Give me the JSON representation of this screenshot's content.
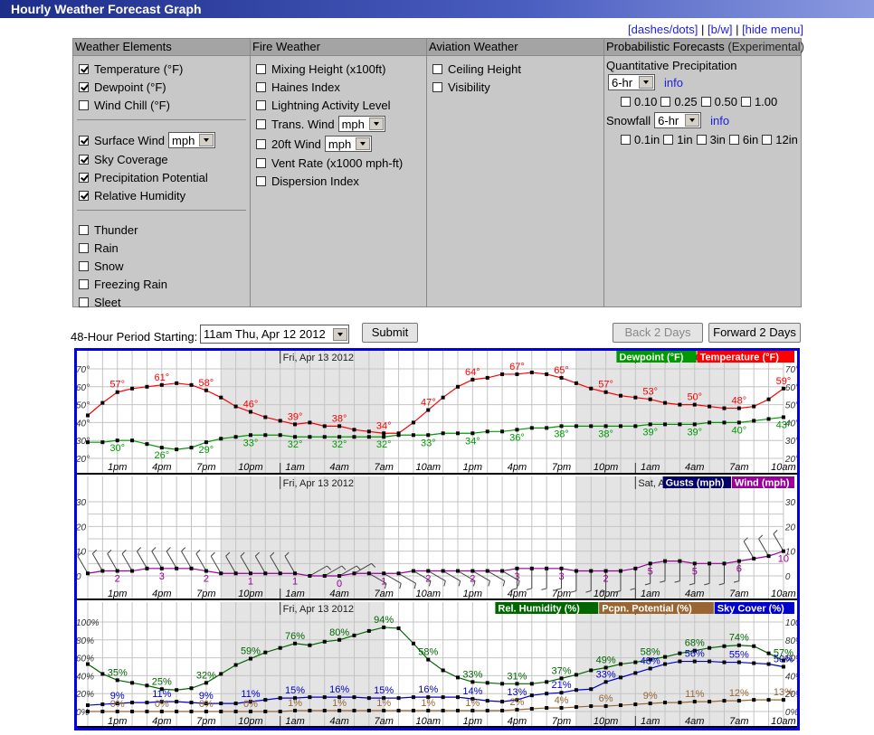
{
  "title": "Hourly Weather Forecast Graph",
  "links": [
    "[dashes/dots]",
    "[b/w]",
    "[hide menu]"
  ],
  "link_sep": " | ",
  "form": {
    "columns": [
      {
        "header": "Weather Elements",
        "groups": [
          [
            {
              "label": "Temperature (°F)",
              "checked": true
            },
            {
              "label": "Dewpoint (°F)",
              "checked": true
            },
            {
              "label": "Wind Chill (°F)",
              "checked": false
            }
          ],
          [
            {
              "label": "Surface Wind",
              "checked": true,
              "select": "mph"
            },
            {
              "label": "Sky Coverage",
              "checked": true
            },
            {
              "label": "Precipitation Potential",
              "checked": true
            },
            {
              "label": "Relative Humidity",
              "checked": true
            }
          ],
          [
            {
              "label": "Thunder",
              "checked": false
            },
            {
              "label": "Rain",
              "checked": false
            },
            {
              "label": "Snow",
              "checked": false
            },
            {
              "label": "Freezing Rain",
              "checked": false
            },
            {
              "label": "Sleet",
              "checked": false
            }
          ]
        ]
      },
      {
        "header": "Fire Weather",
        "groups": [
          [
            {
              "label": "Mixing Height (x100ft)",
              "checked": false
            },
            {
              "label": "Haines Index",
              "checked": false
            },
            {
              "label": "Lightning Activity Level",
              "checked": false
            },
            {
              "label": "Trans. Wind",
              "checked": false,
              "select": "mph"
            },
            {
              "label": "20ft Wind",
              "checked": false,
              "select": "mph"
            },
            {
              "label": "Vent Rate (x1000 mph-ft)",
              "checked": false
            },
            {
              "label": "Dispersion Index",
              "checked": false
            }
          ]
        ]
      },
      {
        "header": "Aviation Weather",
        "groups": [
          [
            {
              "label": "Ceiling Height",
              "checked": false
            },
            {
              "label": "Visibility",
              "checked": false
            }
          ]
        ]
      }
    ],
    "prob": {
      "header": "Probabilistic Forecasts",
      "header_note": "(Experimental)",
      "qpf_label": "Quantitative Precipitation",
      "qpf_select": "6-hr",
      "qpf_info": "info",
      "qpf_options": [
        {
          "label": "0.10",
          "checked": false
        },
        {
          "label": "0.25",
          "checked": false
        },
        {
          "label": "0.50",
          "checked": false
        },
        {
          "label": "1.00",
          "checked": false
        }
      ],
      "snow_label": "Snowfall",
      "snow_select": "6-hr",
      "snow_info": "info",
      "snow_options": [
        {
          "label": "0.1in",
          "checked": false
        },
        {
          "label": "1in",
          "checked": false
        },
        {
          "label": "3in",
          "checked": false
        },
        {
          "label": "6in",
          "checked": false
        },
        {
          "label": "12in",
          "checked": false
        }
      ]
    }
  },
  "period": {
    "label": "48-Hour Period Starting:",
    "value": "11am Thu, Apr 12 2012",
    "submit": "Submit",
    "back": "Back 2 Days",
    "back_disabled": true,
    "forward": "Forward 2 Days"
  },
  "chart_data": {
    "type": "line",
    "start": "11am Thu, Apr 12 2012",
    "interval_hours": 1,
    "x_tick_labels": [
      "1pm",
      "4pm",
      "7pm",
      "10pm",
      "1am",
      "4am",
      "7am",
      "10am",
      "1pm",
      "4pm",
      "7pm",
      "10pm",
      "1am",
      "4am",
      "7am",
      "10am"
    ],
    "day_labels": [
      "Fri, Apr 13 2012",
      "Sat, Apr 14 2012"
    ],
    "night_shading": "8pm–7am",
    "colors": {
      "temperature": "#ff0000",
      "dewpoint": "#009900",
      "wind": "#990099",
      "gusts": "#000066",
      "rh": "#006600",
      "pcpn": "#996633",
      "sky": "#0000cc",
      "border": "#0000ee"
    },
    "panels": [
      {
        "ylim": [
          20,
          70
        ],
        "yticks": [
          "20°",
          "30°",
          "40°",
          "50°",
          "60°",
          "70°"
        ],
        "ytick_values": [
          20,
          30,
          40,
          50,
          60,
          70
        ],
        "legend": [
          "Dewpoint (°F)",
          "Temperature (°F)"
        ],
        "series": [
          {
            "name": "Temperature (°F)",
            "key": "temperature",
            "label_suffix": "°",
            "label_pos": "above",
            "values": [
              44,
              51,
              57,
              59,
              60,
              61,
              62,
              61,
              58,
              54,
              49,
              46,
              43,
              41,
              39,
              40,
              38,
              38,
              36,
              35,
              34,
              34,
              40,
              47,
              54,
              60,
              64,
              65,
              67,
              67,
              68,
              67,
              65,
              62,
              59,
              57,
              55,
              54,
              53,
              51,
              50,
              50,
              49,
              48,
              48,
              49,
              53,
              59
            ]
          },
          {
            "name": "Dewpoint (°F)",
            "key": "dewpoint",
            "label_suffix": "°",
            "label_pos": "below",
            "values": [
              29,
              29,
              30,
              30,
              28,
              26,
              25,
              26,
              29,
              31,
              32,
              33,
              33,
              33,
              32,
              32,
              32,
              32,
              32,
              32,
              32,
              33,
              33,
              33,
              34,
              34,
              34,
              35,
              35,
              36,
              37,
              37,
              38,
              38,
              38,
              38,
              38,
              38,
              39,
              39,
              39,
              39,
              40,
              40,
              40,
              41,
              42,
              43
            ]
          }
        ]
      },
      {
        "ylim": [
          0,
          30
        ],
        "yticks": [
          "0",
          "10",
          "20",
          "30"
        ],
        "ytick_values": [
          0,
          10,
          20,
          30
        ],
        "legend": [
          "Gusts (mph)",
          "Wind (mph)"
        ],
        "series": [
          {
            "name": "Wind (mph)",
            "key": "wind",
            "label_suffix": "",
            "label_pos": "below",
            "values": [
              1,
              2,
              2,
              2,
              3,
              3,
              3,
              3,
              2,
              1,
              1,
              1,
              1,
              1,
              1,
              0,
              0,
              0,
              1,
              1,
              1,
              1,
              2,
              2,
              2,
              2,
              2,
              2,
              2,
              3,
              3,
              3,
              3,
              2,
              2,
              2,
              2,
              3,
              5,
              6,
              6,
              5,
              5,
              5,
              6,
              7,
              8,
              10
            ]
          }
        ],
        "wind_direction_deg": [
          330,
          330,
          330,
          330,
          330,
          330,
          330,
          330,
          330,
          330,
          330,
          330,
          330,
          330,
          330,
          60,
          60,
          60,
          60,
          120,
          120,
          120,
          120,
          120,
          120,
          120,
          120,
          120,
          120,
          180,
          180,
          180,
          180,
          180,
          180,
          180,
          180,
          180,
          180,
          180,
          180,
          180,
          180,
          180,
          180,
          330,
          330,
          330
        ]
      },
      {
        "ylim": [
          0,
          100
        ],
        "yticks": [
          "0%",
          "20%",
          "40%",
          "60%",
          "80%",
          "100%"
        ],
        "ytick_values": [
          0,
          20,
          40,
          60,
          80,
          100
        ],
        "legend": [
          "Rel. Humidity (%)",
          "Pcpn. Potential (%)",
          "Sky Cover (%)"
        ],
        "series": [
          {
            "name": "Rel. Humidity (%)",
            "key": "rh",
            "label_suffix": "%",
            "label_pos": "above",
            "values": [
              53,
              42,
              35,
              32,
              29,
              25,
              24,
              26,
              32,
              42,
              52,
              59,
              66,
              71,
              76,
              74,
              78,
              80,
              85,
              90,
              94,
              93,
              76,
              58,
              46,
              38,
              33,
              32,
              31,
              31,
              31,
              33,
              37,
              41,
              46,
              49,
              53,
              55,
              58,
              61,
              65,
              68,
              71,
              73,
              74,
              73,
              65,
              57
            ]
          },
          {
            "name": "Sky Cover (%)",
            "key": "sky",
            "label_suffix": "%",
            "label_pos": "above",
            "values": [
              7,
              8,
              9,
              10,
              10,
              11,
              11,
              10,
              9,
              9,
              9,
              11,
              13,
              15,
              15,
              16,
              16,
              16,
              16,
              15,
              15,
              15,
              16,
              16,
              16,
              16,
              14,
              12,
              11,
              13,
              18,
              20,
              21,
              24,
              25,
              33,
              38,
              43,
              48,
              53,
              56,
              56,
              56,
              55,
              55,
              54,
              53,
              50
            ]
          },
          {
            "name": "Pcpn. Potential (%)",
            "key": "pcpn",
            "label_suffix": "%",
            "label_pos": "above",
            "values": [
              0,
              0,
              0,
              0,
              0,
              0,
              0,
              0,
              0,
              0,
              0,
              0,
              0,
              0,
              1,
              1,
              1,
              1,
              1,
              1,
              1,
              1,
              1,
              1,
              1,
              1,
              1,
              1,
              1,
              2,
              3,
              4,
              4,
              5,
              6,
              6,
              7,
              8,
              9,
              10,
              10,
              11,
              11,
              12,
              12,
              13,
              13,
              13
            ]
          }
        ]
      }
    ]
  }
}
